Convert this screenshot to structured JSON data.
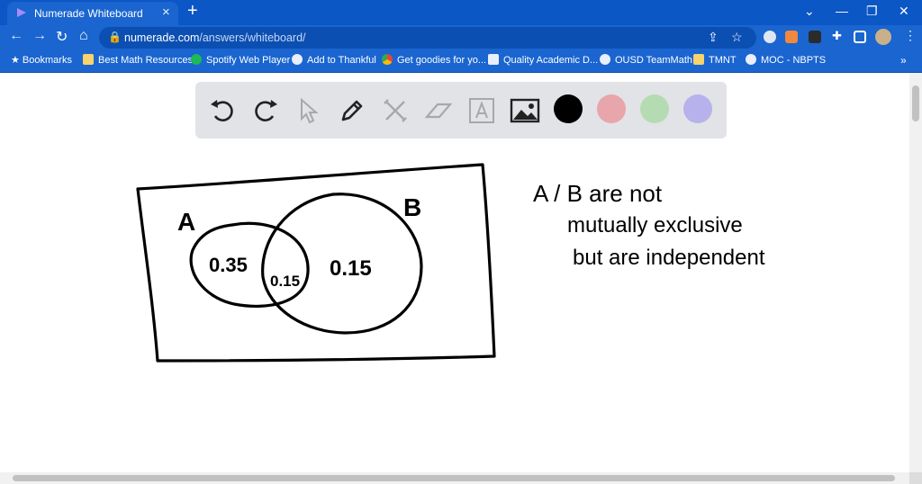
{
  "browser": {
    "tab_title": "Numerade Whiteboard",
    "new_tab": "+",
    "url_host": "numerade.com",
    "url_path": "/answers/whiteboard/"
  },
  "bookmarks": [
    {
      "label": "Bookmarks",
      "icon": "star-icon"
    },
    {
      "label": "Best Math Resources",
      "icon": "folder-icon"
    },
    {
      "label": "Spotify Web Player",
      "icon": "spotify-icon"
    },
    {
      "label": "Add to Thankful",
      "icon": "globe-icon"
    },
    {
      "label": "Get goodies for yo...",
      "icon": "chrome-icon"
    },
    {
      "label": "Quality Academic D...",
      "icon": "doc-icon"
    },
    {
      "label": "OUSD TeamMath",
      "icon": "globe-icon"
    },
    {
      "label": "TMNT",
      "icon": "folder-icon"
    },
    {
      "label": "MOC - NBPTS",
      "icon": "wordpress-icon"
    }
  ],
  "whiteboard": {
    "tools": [
      "undo",
      "redo",
      "select",
      "pen",
      "tools",
      "eraser",
      "text",
      "image"
    ],
    "swatches": [
      "#000000",
      "#e8a5ab",
      "#b5dbb2",
      "#b7b1ec"
    ],
    "handwriting": {
      "label_a": "A",
      "label_b": "B",
      "only_a": "0.35",
      "intersection": "0.15",
      "only_b": "0.15",
      "note_line1": "A / B are not",
      "note_line2": "mutually exclusive",
      "note_line3": "but are independent"
    }
  }
}
